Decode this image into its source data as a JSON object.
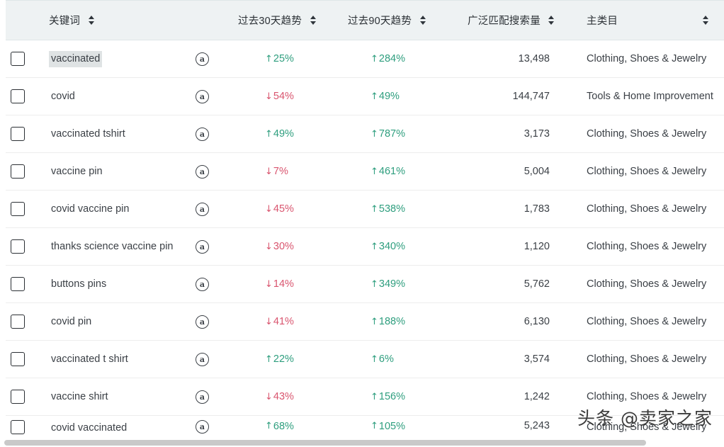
{
  "table": {
    "columns": [
      {
        "id": "checkbox",
        "label": "",
        "sortable": false
      },
      {
        "id": "keyword",
        "label": "关键词",
        "sortable": true
      },
      {
        "id": "amazon",
        "label": "",
        "sortable": false
      },
      {
        "id": "trend30",
        "label": "过去30天趋势",
        "sortable": true
      },
      {
        "id": "trend90",
        "label": "过去90天趋势",
        "sortable": true
      },
      {
        "id": "volume",
        "label": "广泛匹配搜索量",
        "sortable": true
      },
      {
        "id": "category",
        "label": "主类目",
        "sortable": true
      }
    ],
    "icons": {
      "sort": "sort-updown-icon",
      "amazon": "amazon-logo-icon",
      "checkbox": "checkbox-icon"
    },
    "amazon_glyph": "a",
    "arrow_up": "↑",
    "arrow_down": "↓",
    "colors": {
      "up": "#2e9e7e",
      "down": "#d9556f",
      "header_bg": "#eef2f3",
      "highlight": "#dfe3e4",
      "row_border": "#ededed",
      "text": "#3a3f45"
    },
    "rows": [
      {
        "keyword": "vaccinated",
        "highlighted": true,
        "trend30": {
          "dir": "up",
          "value": "25%"
        },
        "trend90": {
          "dir": "up",
          "value": "284%"
        },
        "volume": "13,498",
        "category": "Clothing, Shoes & Jewelry"
      },
      {
        "keyword": "covid",
        "highlighted": false,
        "trend30": {
          "dir": "down",
          "value": "54%"
        },
        "trend90": {
          "dir": "up",
          "value": "49%"
        },
        "volume": "144,747",
        "category": "Tools & Home Improvement"
      },
      {
        "keyword": "vaccinated tshirt",
        "highlighted": false,
        "trend30": {
          "dir": "up",
          "value": "49%"
        },
        "trend90": {
          "dir": "up",
          "value": "787%"
        },
        "volume": "3,173",
        "category": "Clothing, Shoes & Jewelry"
      },
      {
        "keyword": "vaccine pin",
        "highlighted": false,
        "trend30": {
          "dir": "down",
          "value": "7%"
        },
        "trend90": {
          "dir": "up",
          "value": "461%"
        },
        "volume": "5,004",
        "category": "Clothing, Shoes & Jewelry"
      },
      {
        "keyword": "covid vaccine pin",
        "highlighted": false,
        "trend30": {
          "dir": "down",
          "value": "45%"
        },
        "trend90": {
          "dir": "up",
          "value": "538%"
        },
        "volume": "1,783",
        "category": "Clothing, Shoes & Jewelry"
      },
      {
        "keyword": "thanks science vaccine pin",
        "highlighted": false,
        "trend30": {
          "dir": "down",
          "value": "30%"
        },
        "trend90": {
          "dir": "up",
          "value": "340%"
        },
        "volume": "1,120",
        "category": "Clothing, Shoes & Jewelry"
      },
      {
        "keyword": "buttons pins",
        "highlighted": false,
        "trend30": {
          "dir": "down",
          "value": "14%"
        },
        "trend90": {
          "dir": "up",
          "value": "349%"
        },
        "volume": "5,762",
        "category": "Clothing, Shoes & Jewelry"
      },
      {
        "keyword": "covid pin",
        "highlighted": false,
        "trend30": {
          "dir": "down",
          "value": "41%"
        },
        "trend90": {
          "dir": "up",
          "value": "188%"
        },
        "volume": "6,130",
        "category": "Clothing, Shoes & Jewelry"
      },
      {
        "keyword": "vaccinated t shirt",
        "highlighted": false,
        "trend30": {
          "dir": "up",
          "value": "22%"
        },
        "trend90": {
          "dir": "up",
          "value": "6%"
        },
        "volume": "3,574",
        "category": "Clothing, Shoes & Jewelry"
      },
      {
        "keyword": "vaccine shirt",
        "highlighted": false,
        "trend30": {
          "dir": "down",
          "value": "43%"
        },
        "trend90": {
          "dir": "up",
          "value": "156%"
        },
        "volume": "1,242",
        "category": "Clothing, Shoes & Jewelry"
      },
      {
        "keyword": "covid vaccinated",
        "highlighted": false,
        "trend30": {
          "dir": "up",
          "value": "68%"
        },
        "trend90": {
          "dir": "up",
          "value": "105%"
        },
        "volume": "5,243",
        "category": "Clothing, Shoes & Jewelry"
      }
    ]
  },
  "watermark": {
    "text": "头条 @卖家之家"
  }
}
